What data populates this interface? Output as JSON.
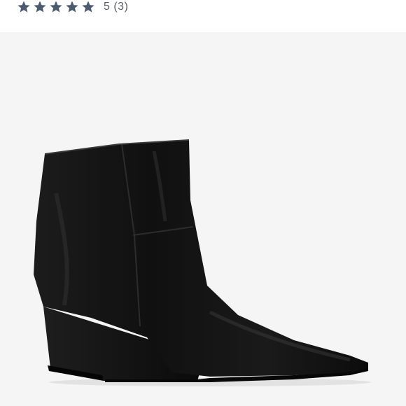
{
  "rating": {
    "stars_filled": 5,
    "stars_total": 5,
    "star_color": "#4c5a70",
    "text": "5 (3)"
  },
  "product": {
    "image_icon": "black-leather-wedge-ankle-boot",
    "background_color": "#f5f5f5",
    "boot_color": "#141414"
  }
}
